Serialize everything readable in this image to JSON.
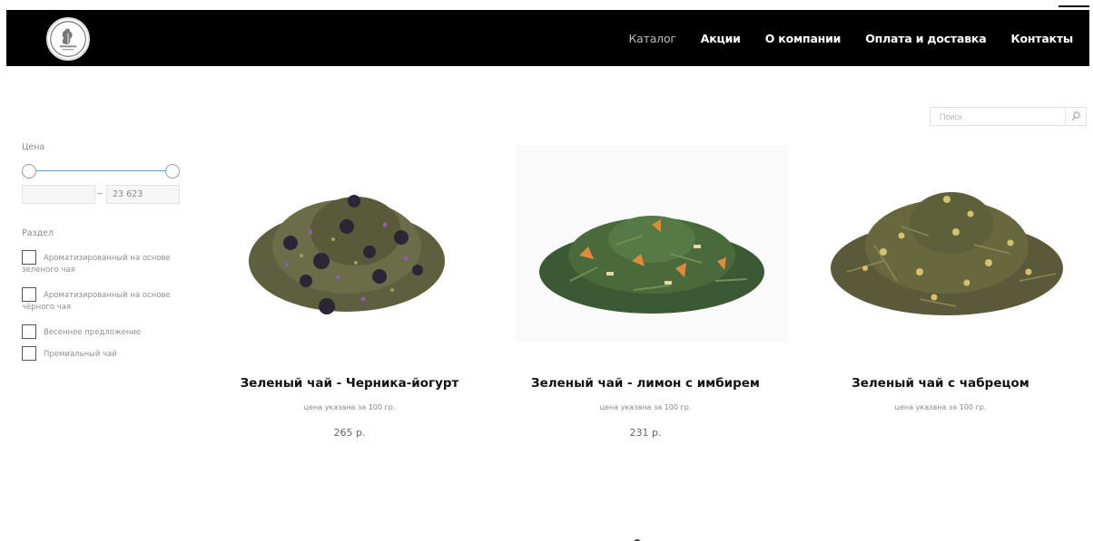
{
  "header": {
    "logo_icon": "premium-tea-logo",
    "nav": [
      {
        "label": "Каталог",
        "active": true
      },
      {
        "label": "Акции",
        "active": false
      },
      {
        "label": "О компании",
        "active": false
      },
      {
        "label": "Оплата и доставка",
        "active": false
      },
      {
        "label": "Контакты",
        "active": false
      }
    ]
  },
  "search": {
    "placeholder": "Поиск",
    "value": "",
    "icon": "search-icon"
  },
  "filters": {
    "price": {
      "label": "Цена",
      "from": "",
      "to": "23 623",
      "dash": "–"
    },
    "section": {
      "label": "Раздел",
      "items": [
        {
          "label": "Ароматизированный на основе зеленого чая",
          "checked": false
        },
        {
          "label": "Ароматизированный на основе чёрного чая",
          "checked": false
        },
        {
          "label": "Весеннее предложение",
          "checked": false
        },
        {
          "label": "Премиальный чай",
          "checked": false
        }
      ]
    }
  },
  "products": [
    {
      "title": "Зеленый чай - Черника-йогурт",
      "note": "цена указана за 100 гр.",
      "price": "265 р.",
      "image_icon": "tea-blueberry-yogurt-image"
    },
    {
      "title": "Зеленый чай - лимон с имбирем",
      "note": "цена указана за 100 гр.",
      "price": "231 р.",
      "image_icon": "tea-lemon-ginger-image"
    },
    {
      "title": "Зеленый чай с чабрецом",
      "note": "цена указана за 100 гр.",
      "price": "",
      "image_icon": "tea-thyme-image"
    }
  ],
  "colors": {
    "header_bg": "#000000",
    "nav_text": "#ffffff",
    "nav_active": "#bdbdbd",
    "slider": "#5b9bd8"
  }
}
